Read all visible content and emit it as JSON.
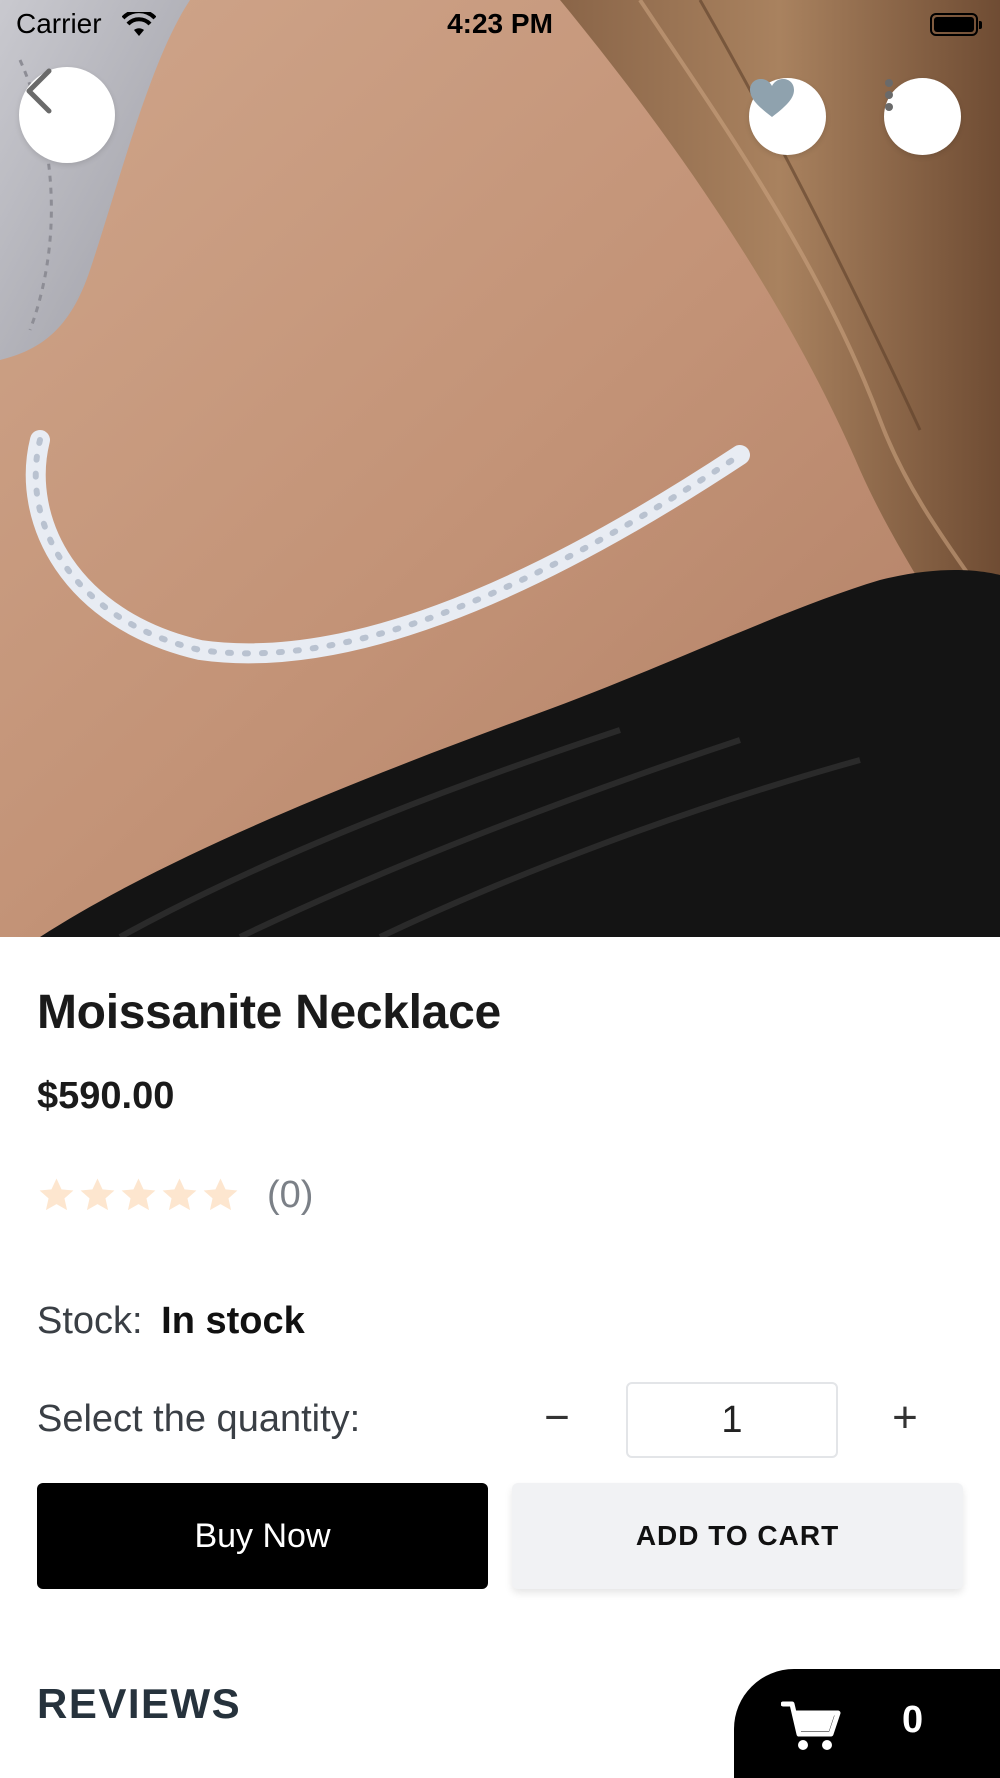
{
  "status_bar": {
    "carrier": "Carrier",
    "time": "4:23 PM"
  },
  "product": {
    "title": "Moissanite Necklace",
    "price": "$590.00",
    "rating": {
      "stars_filled": 0,
      "stars_total": 5,
      "count_text": "(0)",
      "star_color": "#fde6cf"
    },
    "stock_label": "Stock:",
    "stock_value": "In stock",
    "quantity_label": "Select the quantity:",
    "quantity_value": "1",
    "minus_symbol": "−",
    "plus_symbol": "+"
  },
  "actions": {
    "buy_now": "Buy Now",
    "add_to_cart": "ADD TO CART"
  },
  "reviews": {
    "heading": "REVIEWS"
  },
  "cart": {
    "count": "0",
    "icon": "cart-icon"
  },
  "overlay_icons": {
    "back": "chevron-left-icon",
    "favorite": "heart-icon",
    "favorite_color": "#8fa2ae",
    "more": "more-vertical-icon"
  }
}
